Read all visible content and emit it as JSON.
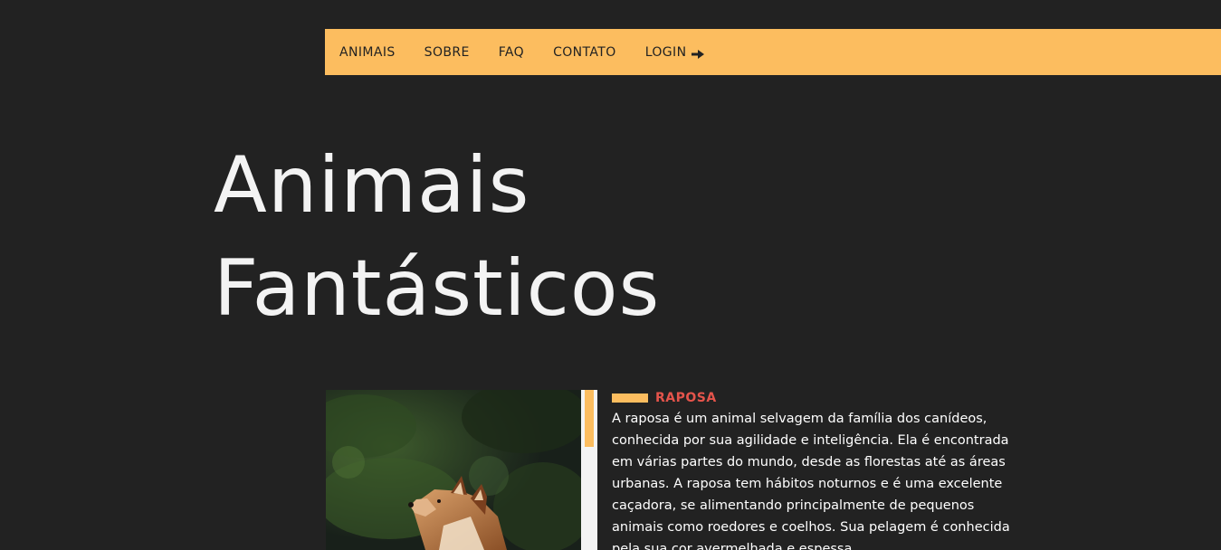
{
  "menu": {
    "items": [
      {
        "label": "ANIMAIS"
      },
      {
        "label": "SOBRE"
      },
      {
        "label": "FAQ"
      },
      {
        "label": "CONTATO"
      },
      {
        "label": "LOGIN"
      }
    ],
    "login_icon": "arrow-right-icon"
  },
  "hero": {
    "title_line1": "Animais",
    "title_line2": "Fantásticos"
  },
  "animal": {
    "name": "RAPOSA",
    "description": "A raposa é um animal selvagem da família dos canídeos, conhecida por sua agilidade e inteligência. Ela é encontrada em várias partes do mundo, desde as florestas até as áreas urbanas. A raposa tem hábitos noturnos e é uma excelente caçadora, se alimentando principalmente de pequenos animais como roedores e coelhos. Sua pelagem é conhecida pela sua cor avermelhada e espessa."
  },
  "colors": {
    "background": "#222222",
    "accent": "#fcbd5f",
    "title_text": "#f3f3f3",
    "animal_name": "#e5544b",
    "scrollbar_track": "#f4f4f4"
  }
}
